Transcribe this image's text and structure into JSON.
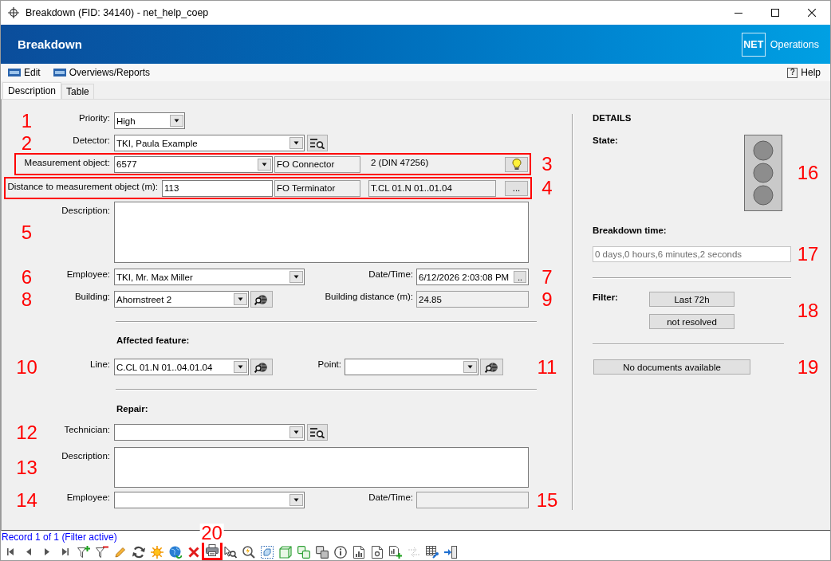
{
  "window": {
    "title": "Breakdown (FID: 34140) - net_help_coep"
  },
  "header": {
    "title": "Breakdown",
    "logo": "NET",
    "product": "Operations"
  },
  "menu": {
    "items": [
      {
        "label": "Edit"
      },
      {
        "label": "Overviews/Reports"
      }
    ],
    "help": {
      "icon": "?",
      "label": "Help"
    }
  },
  "tabs": [
    {
      "label": "Description",
      "selected": true
    },
    {
      "label": "Table",
      "selected": false
    }
  ],
  "breakdown": {
    "priority": {
      "callout": "1",
      "label": "Priority:",
      "value": "High"
    },
    "detector": {
      "callout": "2",
      "label": "Detector:",
      "value": "TKI, Paula Example"
    },
    "measurement_object": {
      "callout": "3",
      "highlighted": true,
      "label": "Measurement object:",
      "value": "6577",
      "type": {
        "value": "FO Connector",
        "readonly": true
      },
      "info": "2 (DIN 47256)"
    },
    "distance": {
      "callout": "4",
      "highlighted": true,
      "label": "Distance to measurement object (m):",
      "value": "113",
      "type": {
        "value": "FO Terminator",
        "readonly": true
      },
      "reference": {
        "value": "T.CL 01.N 01..01.04",
        "readonly": true
      },
      "button": "..."
    },
    "description": {
      "callout": "5",
      "label": "Description:"
    },
    "employee": {
      "callout": "6",
      "label": "Employee:",
      "value": "TKI, Mr. Max Miller"
    },
    "date_time": {
      "callout": "7",
      "label": "Date/Time:",
      "value": "6/12/2026 2:03:08 PM",
      "button": ".."
    },
    "building": {
      "callout": "8",
      "label": "Building:",
      "value": "Ahornstreet 2"
    },
    "building_distance": {
      "callout": "9",
      "label": "Building distance (m):",
      "value": "24.85",
      "readonly": true
    }
  },
  "affected_feature": {
    "heading": "Affected feature:",
    "line": {
      "callout": "10",
      "label": "Line:",
      "value": "C.CL 01.N 01..04.01.04"
    },
    "point": {
      "callout": "11",
      "label": "Point:"
    }
  },
  "repair": {
    "heading": "Repair:",
    "technician": {
      "callout": "12",
      "label": "Technician:"
    },
    "description": {
      "callout": "13",
      "label": "Description:"
    },
    "employee": {
      "callout": "14",
      "label": "Employee:"
    },
    "date_time": {
      "callout": "15",
      "label": "Date/Time:",
      "readonly": true
    }
  },
  "details": {
    "heading": "DETAILS",
    "state": {
      "label": "State:",
      "callout": "16",
      "lights": [
        {
          "on": false
        },
        {
          "on": false
        },
        {
          "on": false
        }
      ]
    },
    "breakdown_time": {
      "label": "Breakdown time:",
      "value": "0 days,0 hours,6 minutes,2 seconds",
      "disabled": true,
      "callout": "17"
    },
    "filter": {
      "label": "Filter:",
      "buttons": [
        "Last 72h",
        "not resolved"
      ],
      "callout": "18"
    },
    "documents": {
      "button": "No documents available",
      "callout": "19"
    }
  },
  "status_bar": {
    "record": "Record 1 of 1 (Filter active)"
  },
  "toolbar": [
    {
      "kind": "first",
      "disabled": false
    },
    {
      "kind": "previous",
      "disabled": false
    },
    {
      "kind": "next",
      "disabled": false
    },
    {
      "kind": "last",
      "disabled": false
    },
    {
      "kind": "filteradd",
      "disabled": false
    },
    {
      "kind": "filterremove",
      "disabled": false
    },
    {
      "kind": "pencil",
      "disabled": false
    },
    {
      "kind": "refresh",
      "disabled": false
    },
    {
      "kind": "sun",
      "disabled": false
    },
    {
      "kind": "globe",
      "disabled": false
    },
    {
      "kind": "delete",
      "disabled": false
    },
    {
      "kind": "print",
      "disabled": false,
      "highlighted": true,
      "callout": "20"
    },
    {
      "kind": "cursor",
      "disabled": false
    },
    {
      "kind": "zoom",
      "disabled": false
    },
    {
      "kind": "frame",
      "disabled": false
    },
    {
      "kind": "cube",
      "disabled": false
    },
    {
      "kind": "cubes",
      "disabled": false
    },
    {
      "kind": "squares",
      "disabled": false
    },
    {
      "kind": "info",
      "disabled": false
    },
    {
      "kind": "chart",
      "disabled": false
    },
    {
      "kind": "document",
      "disabled": false
    },
    {
      "kind": "report",
      "disabled": false
    },
    {
      "kind": "arrows",
      "disabled": true
    },
    {
      "kind": "table",
      "disabled": false
    },
    {
      "kind": "exit",
      "disabled": false
    }
  ]
}
